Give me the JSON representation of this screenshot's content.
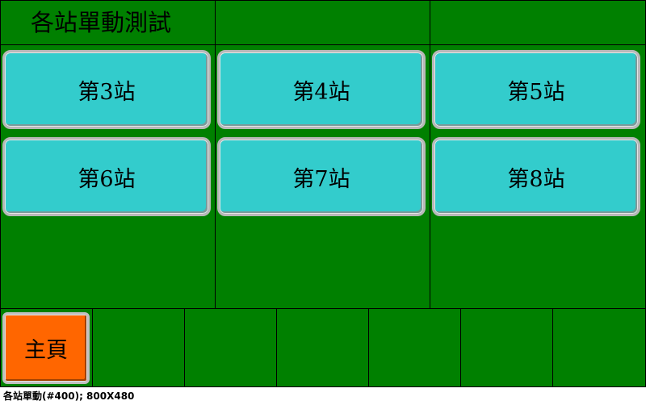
{
  "screen": {
    "title": "各站單動測試",
    "background_color": "#008000",
    "grid_line_color": "#000000"
  },
  "stations": [
    {
      "label": "第3站"
    },
    {
      "label": "第4站"
    },
    {
      "label": "第5站"
    },
    {
      "label": "第6站"
    },
    {
      "label": "第7站"
    },
    {
      "label": "第8站"
    }
  ],
  "station_button_color": "#33cccc",
  "home_button": {
    "label": "主頁",
    "color": "#ff6600"
  },
  "footer": {
    "text": "各站單動(#400); 800X480"
  }
}
